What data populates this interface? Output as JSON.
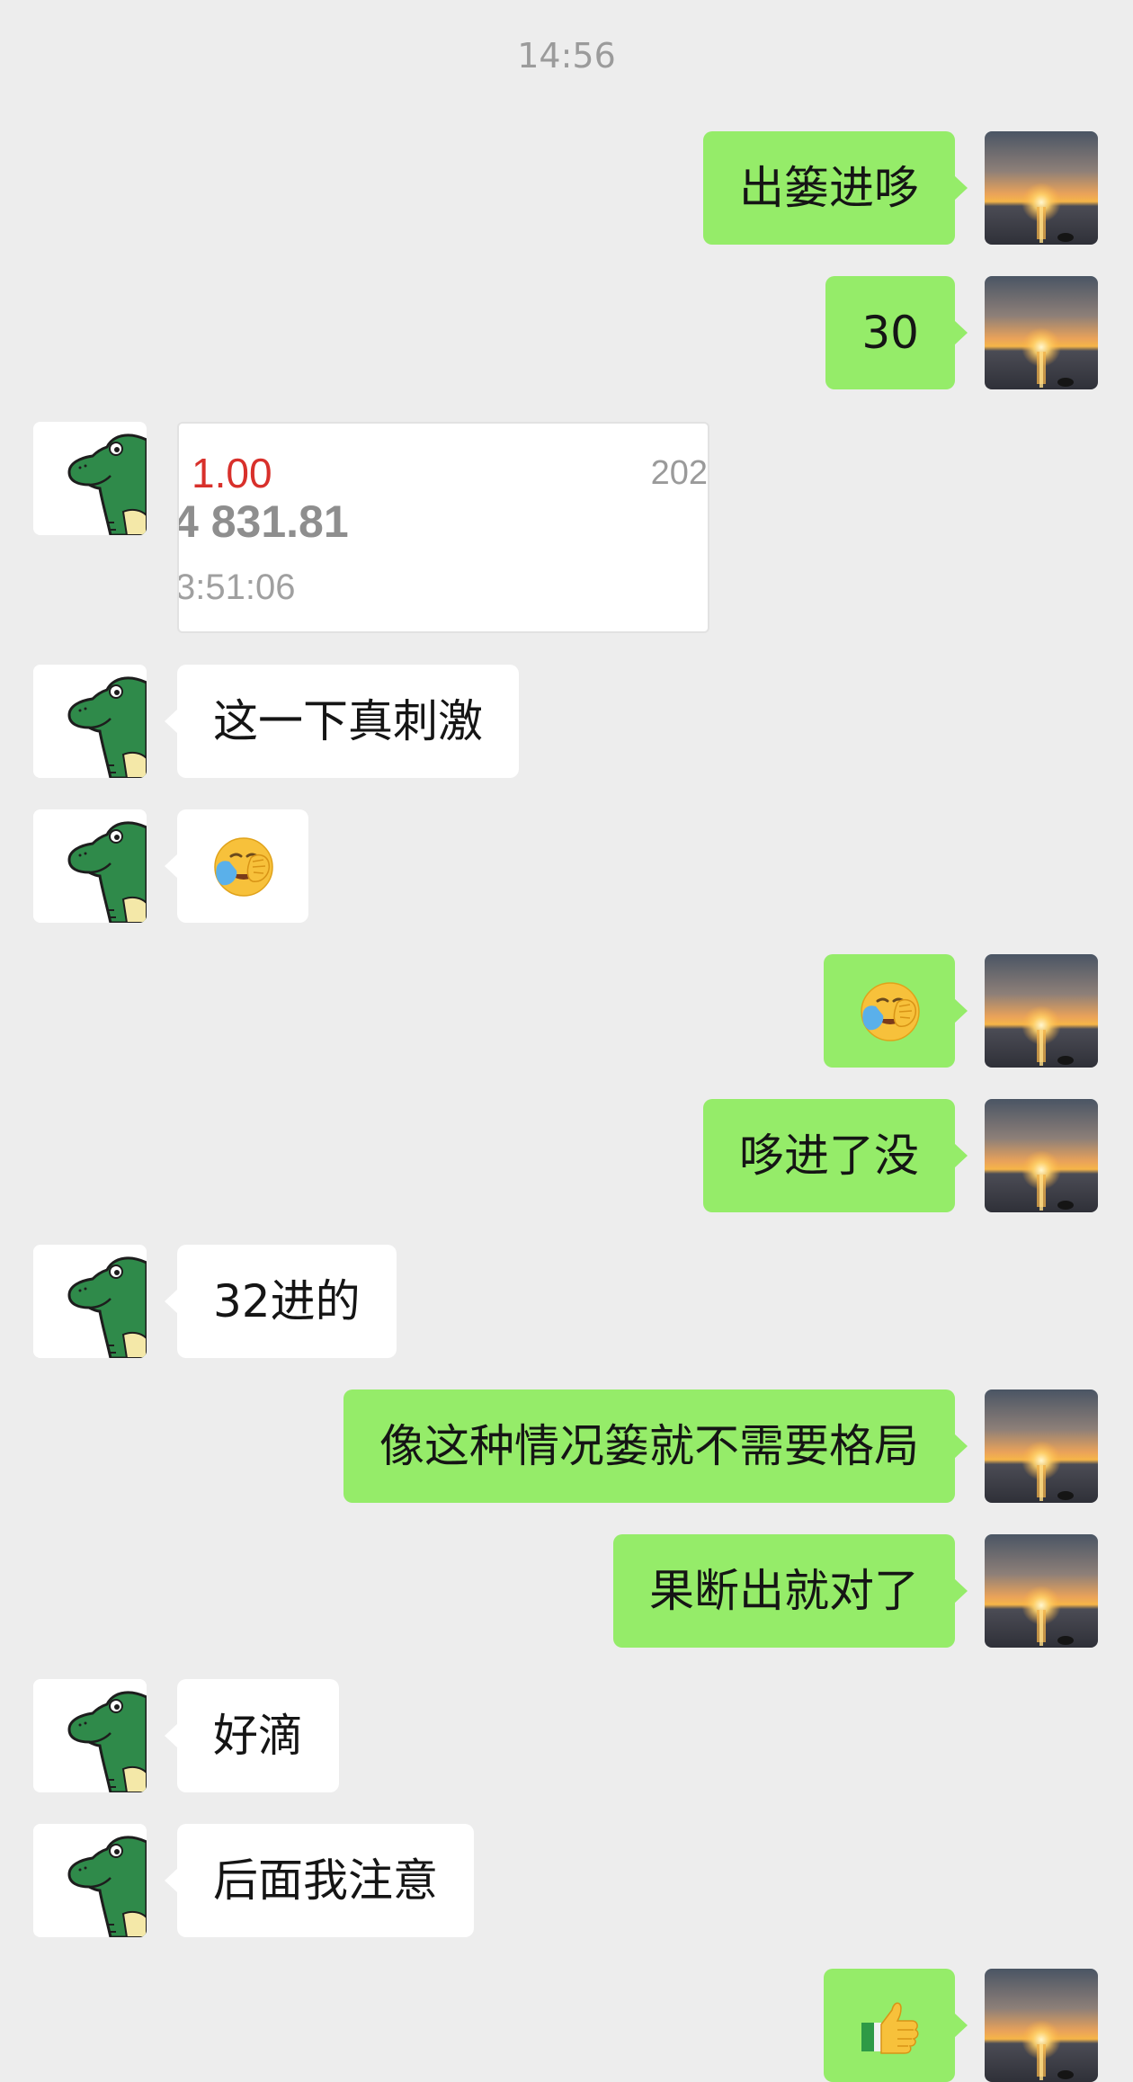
{
  "chat": {
    "timestamp": "14:56",
    "messages": [
      {
        "sender": "me",
        "text": "出篓进哆"
      },
      {
        "sender": "me",
        "text": "30"
      },
      {
        "sender": "them",
        "type": "image"
      },
      {
        "sender": "them",
        "text": "这一下真刺激"
      },
      {
        "sender": "them",
        "type": "emoji",
        "emoji": "facepalm-crying-emoji"
      },
      {
        "sender": "me",
        "type": "emoji",
        "emoji": "facepalm-crying-emoji"
      },
      {
        "sender": "me",
        "text": "哆进了没"
      },
      {
        "sender": "them",
        "text": "32进的"
      },
      {
        "sender": "me",
        "text": "像这种情况篓就不需要格局"
      },
      {
        "sender": "me",
        "text": "果断出就对了"
      },
      {
        "sender": "them",
        "text": "好滴"
      },
      {
        "sender": "them",
        "text": "后面我注意"
      },
      {
        "sender": "me",
        "type": "emoji",
        "emoji": "thumbs-up-emoji"
      }
    ]
  },
  "screenshot_card": {
    "value": "1.00",
    "year": "202",
    "index": "4 831.81",
    "time": "3:51:06",
    "fragment": "..."
  },
  "colors": {
    "background": "#ededed",
    "my_bubble": "#95ec69",
    "their_bubble": "#ffffff",
    "timestamp_text": "#9b9b9b",
    "card_red": "#d8302b"
  },
  "avatars": {
    "me": "sunset-sea-avatar",
    "them": "green-crocodile-avatar"
  }
}
